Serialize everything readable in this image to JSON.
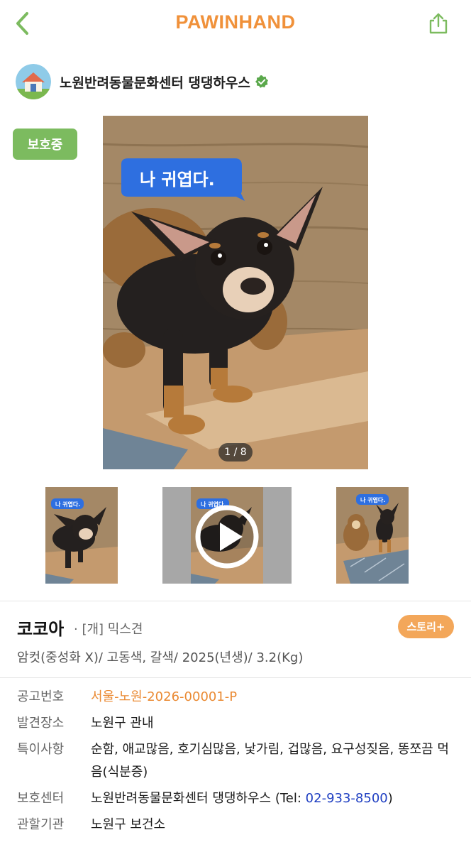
{
  "header": {
    "brand": "PAWINHAND",
    "brand_color": "#f0913a",
    "back_icon": "chevron-left-icon",
    "share_icon": "share-icon"
  },
  "shelter": {
    "name": "노원반려동물문화센터 댕댕하우스",
    "avatar_icon": "house-icon",
    "verified_icon": "verified-check-icon"
  },
  "status_badge": "보호중",
  "photo": {
    "caption_bubble": "나 귀엽다.",
    "counter": "1 / 8"
  },
  "thumbnails": [
    {
      "caption": "나 귀엽다.",
      "type": "photo"
    },
    {
      "caption": "나 귀엽다.",
      "type": "video"
    },
    {
      "caption": "나 귀엽다.",
      "type": "photo"
    }
  ],
  "pet": {
    "name": "코코아",
    "kind": "· [개] 믹스견",
    "summary": "암컷(중성화 X)/ 고동색, 갈색/ 2025(년생)/ 3.2(Kg)",
    "story_button": "스토리+"
  },
  "details": {
    "notice_label": "공고번호",
    "notice_value": "서울-노원-2026-00001-P",
    "found_label": "발견장소",
    "found_value": "노원구 관내",
    "traits_label": "특이사항",
    "traits_value": "순함, 애교많음, 호기심많음, 낯가림, 겁많음, 요구성짖음, 똥쪼끔 먹음(식분증)",
    "center_label": "보호센터",
    "center_value": "노원반려동물문화센터 댕댕하우스 (Tel: ",
    "center_tel": "02-933-8500",
    "center_close": ")",
    "agency_label": "관할기관",
    "agency_value": "노원구 보건소"
  },
  "colors": {
    "accent_orange": "#f0913a",
    "status_green": "#7cbb5f",
    "story_orange": "#f3a75a",
    "tel_blue": "#1f3fc2",
    "bubble_blue": "#2e6fe0"
  }
}
